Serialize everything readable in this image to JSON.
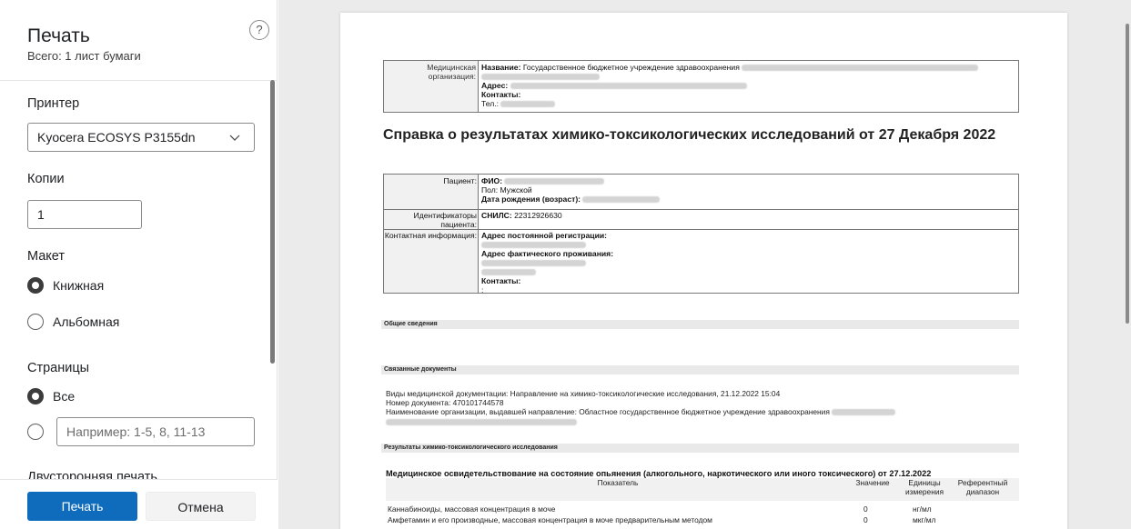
{
  "panel": {
    "title": "Печать",
    "subtitle": "Всего: 1 лист бумаги",
    "help_icon": "?",
    "printer_label": "Принтер",
    "printer_value": "Kyocera ECOSYS P3155dn",
    "copies_label": "Копии",
    "copies_value": "1",
    "layout_label": "Макет",
    "layout_options": [
      "Книжная",
      "Альбомная"
    ],
    "pages_label": "Страницы",
    "pages_all": "Все",
    "pages_placeholder": "Например: 1-5, 8, 11-13",
    "duplex_label": "Двусторонняя печать",
    "print_button": "Печать",
    "cancel_button": "Отмена",
    "accent_color": "#0f6cbd"
  },
  "document": {
    "org": {
      "label": "Медицинская организация:",
      "name_label": "Название:",
      "name_value": "Государственное бюджетное учреждение здравоохранения",
      "address_label": "Адрес:",
      "contacts_label": "Контакты:",
      "phone_label": "Тел.:"
    },
    "title": "Справка о результатах химико-токсикологических исследований от 27 Декабря 2022",
    "patient": {
      "label": "Пациент:",
      "fio_label": "ФИО:",
      "sex": "Пол: Мужской",
      "dob_label": "Дата рождения (возраст):",
      "ids_label": "Идентификаторы пациента:",
      "snils_label": "СНИЛС:",
      "snils_value": "22312926630",
      "contact_label": "Контактная информация:",
      "reg_address_label": "Адрес постоянной регистрации:",
      "fact_address_label": "Адрес фактического проживания:",
      "contacts_label": "Контакты:",
      "colon": ":"
    },
    "sections": {
      "general": "Общие сведения",
      "related": "Связанные документы",
      "results": "Результаты химико-токсикологического исследования"
    },
    "related_lines": [
      "Виды медицинской документации: Направление на химико-токсикологические исследования, 21.12.2022 15:04",
      "Номер документа: 470101744578",
      "Наименование организации, выдавшей направление: Областное государственное бюджетное учреждение здравоохранения"
    ],
    "results_title": "Медицинское освидетельствование на состояние опьянения (алкогольного, наркотического или иного токсического) от 27.12.2022",
    "results_headers": [
      "Показатель",
      "Значение",
      "Единицы измерения",
      "Референтный диапазон"
    ],
    "results_rows": [
      [
        "Каннабиноиды, массовая концентрация в моче",
        "0",
        "нг/мл",
        ""
      ],
      [
        "Амфетамин и его производные, массовая концентрация в моче предварительным методом",
        "0",
        "мкг/мл",
        ""
      ]
    ]
  }
}
